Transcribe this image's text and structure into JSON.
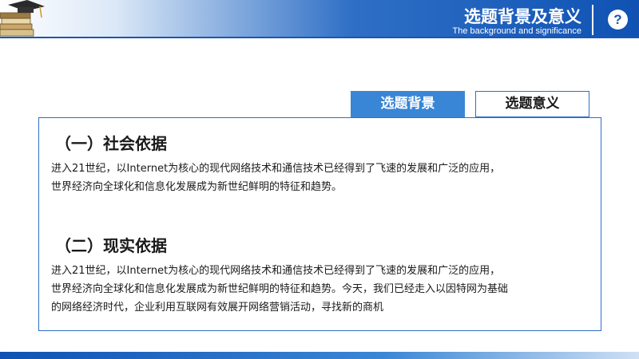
{
  "header": {
    "title": "选题背景及意义",
    "subtitle": "The background and significance",
    "help_icon": "question-mark-icon",
    "help_glyph": "?"
  },
  "tabs": [
    {
      "label": "选题背景",
      "active": true
    },
    {
      "label": "选题意义",
      "active": false
    }
  ],
  "sections": [
    {
      "heading": "（一）社会依据",
      "lines": [
        "进入21世纪，以Internet为核心的现代网络技术和通信技术已经得到了飞速的发展和广泛的应用，",
        "世界经济向全球化和信息化发展成为新世纪鲜明的特征和趋势。"
      ]
    },
    {
      "heading": "（二）现实依据",
      "lines": [
        "进入21世纪，以Internet为核心的现代网络技术和通信技术已经得到了飞速的发展和广泛的应用，",
        "世界经济向全球化和信息化发展成为新世纪鲜明的特征和趋势。今天，我们已经走入以因特网为基础",
        "的网络经济时代，企业利用互联网有效展开网络营销活动，寻找新的商机"
      ]
    }
  ],
  "colors": {
    "primary": "#1a57b0",
    "tab_active": "#3a86d6",
    "border": "#2f6fc6"
  }
}
